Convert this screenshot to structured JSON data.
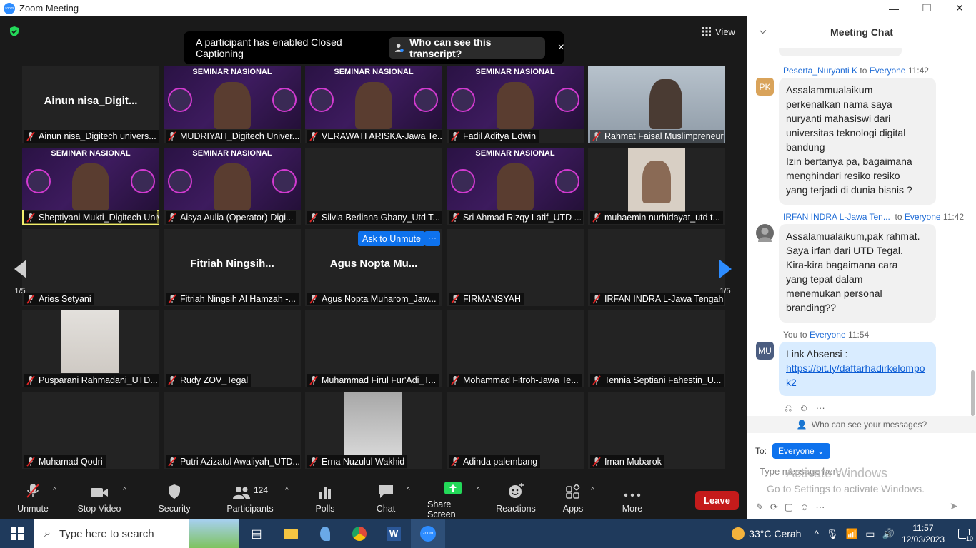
{
  "window": {
    "title": "Zoom Meeting",
    "minimize": "—",
    "maximize": "❐",
    "close": "✕"
  },
  "view_label": "View",
  "caption_banner": {
    "message": "A participant has enabled Closed Captioning",
    "button": "Who can see this transcript?",
    "close": "×"
  },
  "ask_to_unmute": "Ask to Unmute",
  "ask_more": "···",
  "page_indicator": {
    "left": "1/5",
    "right": "1/5"
  },
  "tiles": [
    {
      "name": "Ainun nisa_Digitech univers...",
      "center": "Ainun  nisa_Digit...",
      "kind": "name"
    },
    {
      "name": "MUDRIYAH_Digitech Univer...",
      "kind": "banner",
      "banner_title": "SEMINAR NASIONAL"
    },
    {
      "name": "VERAWATI ARISKA-Jawa Te...",
      "kind": "banner",
      "banner_title": "SEMINAR NASIONAL"
    },
    {
      "name": "Fadil Aditya Edwin",
      "kind": "banner",
      "banner_title": "SEMINAR NASIONAL"
    },
    {
      "name": "Rahmat Faisal Muslimpreneur",
      "kind": "video"
    },
    {
      "name": "Sheptiyani Mukti_Digitech Univ...",
      "kind": "banner",
      "banner_title": "SEMINAR NASIONAL",
      "active": true
    },
    {
      "name": "Aisya Aulia (Operator)-Digi...",
      "kind": "banner",
      "banner_title": "SEMINAR NASIONAL"
    },
    {
      "name": "Silvia Berliana Ghany_Utd T...",
      "kind": "empty"
    },
    {
      "name": "Sri Ahmad Rizqy Latif_UTD ...",
      "kind": "banner",
      "banner_title": "SEMINAR NASIONAL"
    },
    {
      "name": "muhaemin nurhidayat_utd t...",
      "kind": "photo"
    },
    {
      "name": "Aries Setyani",
      "kind": "empty"
    },
    {
      "name": "Fitriah Ningsih Al Hamzah -...",
      "center": "Fitriah  Ningsih...",
      "kind": "name"
    },
    {
      "name": "Agus Nopta Muharom_Jaw...",
      "center": "Agus Nopta Mu...",
      "kind": "name"
    },
    {
      "name": "FIRMANSYAH",
      "kind": "empty"
    },
    {
      "name": "IRFAN INDRA L-Jawa Tengah",
      "kind": "empty"
    },
    {
      "name": "Pusparani Rahmadani_UTD...",
      "kind": "photo2"
    },
    {
      "name": "Rudy ZOV_Tegal",
      "kind": "empty"
    },
    {
      "name": "Muhammad Firul Fur'Adi_T...",
      "kind": "empty"
    },
    {
      "name": "Mohammad Fitroh-Jawa Te...",
      "kind": "empty"
    },
    {
      "name": "Tennia Septiani Fahestin_U...",
      "kind": "empty"
    },
    {
      "name": "Muhamad Qodri",
      "kind": "empty"
    },
    {
      "name": "Putri Azizatul Awaliyah_UTD...",
      "kind": "empty"
    },
    {
      "name": "Erna Nuzulul Wakhid",
      "kind": "photo3"
    },
    {
      "name": "Adinda palembang",
      "kind": "empty"
    },
    {
      "name": "Iman Mubarok",
      "kind": "empty"
    }
  ],
  "toolbar": {
    "unmute": "Unmute",
    "stop_video": "Stop Video",
    "security": "Security",
    "participants": "Participants",
    "participants_count": "124",
    "polls": "Polls",
    "chat": "Chat",
    "share_screen": "Share Screen",
    "reactions": "Reactions",
    "apps": "Apps",
    "more": "More",
    "leave": "Leave"
  },
  "chat": {
    "title": "Meeting Chat",
    "messages": [
      {
        "sender": "Peserta_Nuryanti K",
        "to": "to",
        "recipient": "Everyone",
        "time": "11:42",
        "avatar": "PK",
        "avatar_color": "#d9a35a",
        "text": "Assalammualaikum\nperkenalkan nama saya\nnuryanti mahasiswi dari\nuniversitas teknologi digital\nbandung\nIzin bertanya pa, bagaimana\nmenghindari resiko resiko\nyang terjadi di dunia bisnis ?"
      },
      {
        "sender": "IRFAN INDRA L-Jawa Ten...",
        "to": "to",
        "recipient": "Everyone",
        "time": "11:42",
        "avatar": "",
        "avatar_color": "#6a6a6a",
        "text": "Assalamualaikum,pak rahmat.\nSaya irfan dari UTD Tegal.\nKira-kira bagaimana cara\nyang tepat dalam\nmenemukan personal\nbranding??"
      },
      {
        "sender": "You",
        "to": "to",
        "recipient": "Everyone",
        "time": "11:54",
        "avatar": "MU",
        "avatar_color": "#4b5d80",
        "text": "Link Absensi :",
        "link": "https://bit.ly/daftarhadirkelompok2"
      }
    ],
    "who_can_see": "Who can see your messages?",
    "to_label": "To:",
    "to_value": "Everyone",
    "placeholder": "Type message here...",
    "watermark_title": "Activate Windows",
    "watermark_sub": "Go to Settings to activate Windows."
  },
  "taskbar": {
    "search_placeholder": "Type here to search",
    "weather": "33°C  Cerah",
    "time": "11:57",
    "date": "12/03/2023",
    "notif_count": "10"
  }
}
